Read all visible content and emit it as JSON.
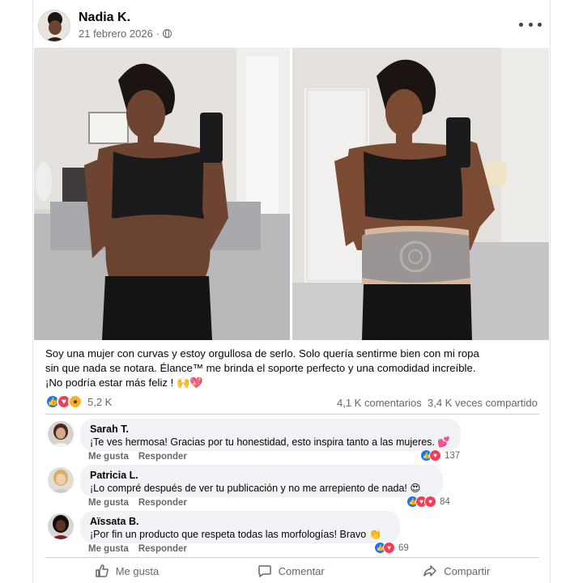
{
  "post": {
    "author": "Nadia K.",
    "date": "21 febrero 2026",
    "separator": "·",
    "caption_lines": [
      "Soy una mujer con curvas y estoy orgullosa de serlo. Solo quería sentirme bien con mi ropa",
      "sin que nada se notara. Élance™ me brinda el soporte perfecto y una comodidad increíble.",
      "¡No podría estar más feliz ! 🙌💖"
    ]
  },
  "stats": {
    "reaction_count": "5,2 K",
    "comments": "4,1 K comentarios",
    "shares": "3,4 K veces compartido",
    "reaction_icons": [
      "like-icon",
      "love-icon",
      "wow-icon"
    ]
  },
  "comments": [
    {
      "name": "Sarah T.",
      "text": "¡Te ves hermosa! Gracias por tu honestidad, esto inspira tanto a las mujeres. 💕",
      "like_label": "Me gusta",
      "reply_label": "Responder",
      "count": "137"
    },
    {
      "name": "Patricia L.",
      "text": "¡Lo compré después de ver tu publicación y no me arrepiento de nada! 😍",
      "like_label": "Me gusta",
      "reply_label": "Responder",
      "count": "84"
    },
    {
      "name": "Aïssata B.",
      "text": "¡Por fin un producto que respeta todas las morfologías! Bravo 👏",
      "like_label": "Me gusta",
      "reply_label": "Responder",
      "count": "69"
    }
  ],
  "actions": {
    "like": "Me gusta",
    "comment": "Comentar",
    "share": "Compartir"
  },
  "colors": {
    "like_blue": "#1877f2",
    "love_red": "#f33e58",
    "wow_yellow": "#f7b125",
    "meta_gray": "#65676b",
    "bubble_bg": "#f0f2f5"
  }
}
